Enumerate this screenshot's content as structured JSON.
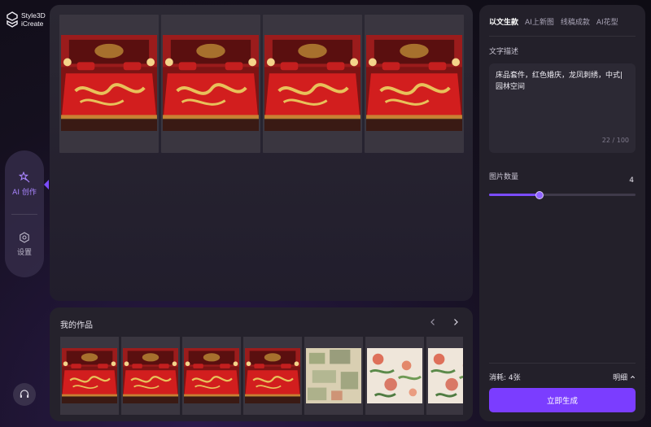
{
  "brand": {
    "line1": "Style3D",
    "line2": "iCreate"
  },
  "side_nav": {
    "items": [
      {
        "label": "AI 创作",
        "icon": "magic-wand-icon",
        "active": true
      },
      {
        "label": "设置",
        "icon": "gear-icon",
        "active": false
      }
    ],
    "accent": "#7b4cff"
  },
  "gallery": {
    "images": [
      {
        "icon": "red-dragon-bedding-image"
      },
      {
        "icon": "red-dragon-bedding-image"
      },
      {
        "icon": "red-dragon-bedding-image"
      },
      {
        "icon": "red-dragon-bedding-image"
      }
    ]
  },
  "works": {
    "title": "我的作品",
    "prev_icon": "chevron-left-icon",
    "next_icon": "chevron-right-icon",
    "thumbnails": [
      {
        "kind": "bedroom"
      },
      {
        "kind": "bedroom"
      },
      {
        "kind": "bedroom"
      },
      {
        "kind": "bedroom"
      },
      {
        "kind": "pattern-green"
      },
      {
        "kind": "pattern-floral"
      },
      {
        "kind": "pattern-floral"
      }
    ]
  },
  "panel": {
    "tabs": [
      {
        "label": "以文生款",
        "active": true
      },
      {
        "label": "AI上新图",
        "active": false
      },
      {
        "label": "线稿成款",
        "active": false
      },
      {
        "label": "AI花型",
        "active": false
      }
    ],
    "text_label": "文字描述",
    "text_value_line1": "床品套件，红色婚庆，龙凤刺绣，中式|",
    "text_value_line2": "园林空间",
    "char_count": "22 / 100",
    "image_count_label": "图片数量",
    "image_count_value": "4",
    "slider_fraction": 0.34,
    "cost": "消耗:  4张",
    "detail": "明细",
    "generate": "立即生成",
    "button_color": "#7b3dff"
  }
}
